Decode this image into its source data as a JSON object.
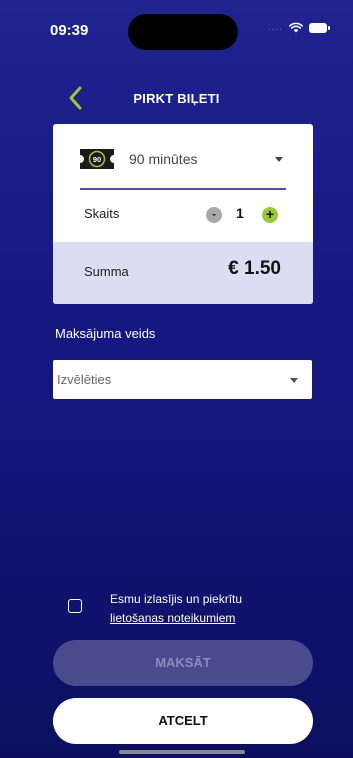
{
  "status_bar": {
    "time": "09:39",
    "signal_dots": "....",
    "icons": [
      "wifi-icon",
      "battery-icon"
    ]
  },
  "header": {
    "title": "PIRKT BIĻETI",
    "back_icon": "chevron-left-icon"
  },
  "ticket": {
    "icon": "ticket-90-icon",
    "icon_text": "90",
    "type_label": "90 minūtes",
    "count_label": "Skaits",
    "minus_label": "-",
    "count": "1",
    "plus_label": "+",
    "sum_label": "Summa",
    "sum_value": "€ 1.50"
  },
  "payment": {
    "label": "Maksājuma veids",
    "select_value": "Izvēlēties"
  },
  "terms": {
    "text": "Esmu izlasījis un piekrītu",
    "link": "lietošanas noteikumiem",
    "checked": false
  },
  "buttons": {
    "pay": "MAKSĀT",
    "cancel": "ATCELT"
  },
  "colors": {
    "background_top": "#20248f",
    "background_bottom": "#0d0f5e",
    "accent_green": "#9cc93a",
    "accent_purple": "#5b4c9f",
    "sum_band": "#dcdcf3",
    "pay_button_disabled": "#4a4b8e"
  }
}
